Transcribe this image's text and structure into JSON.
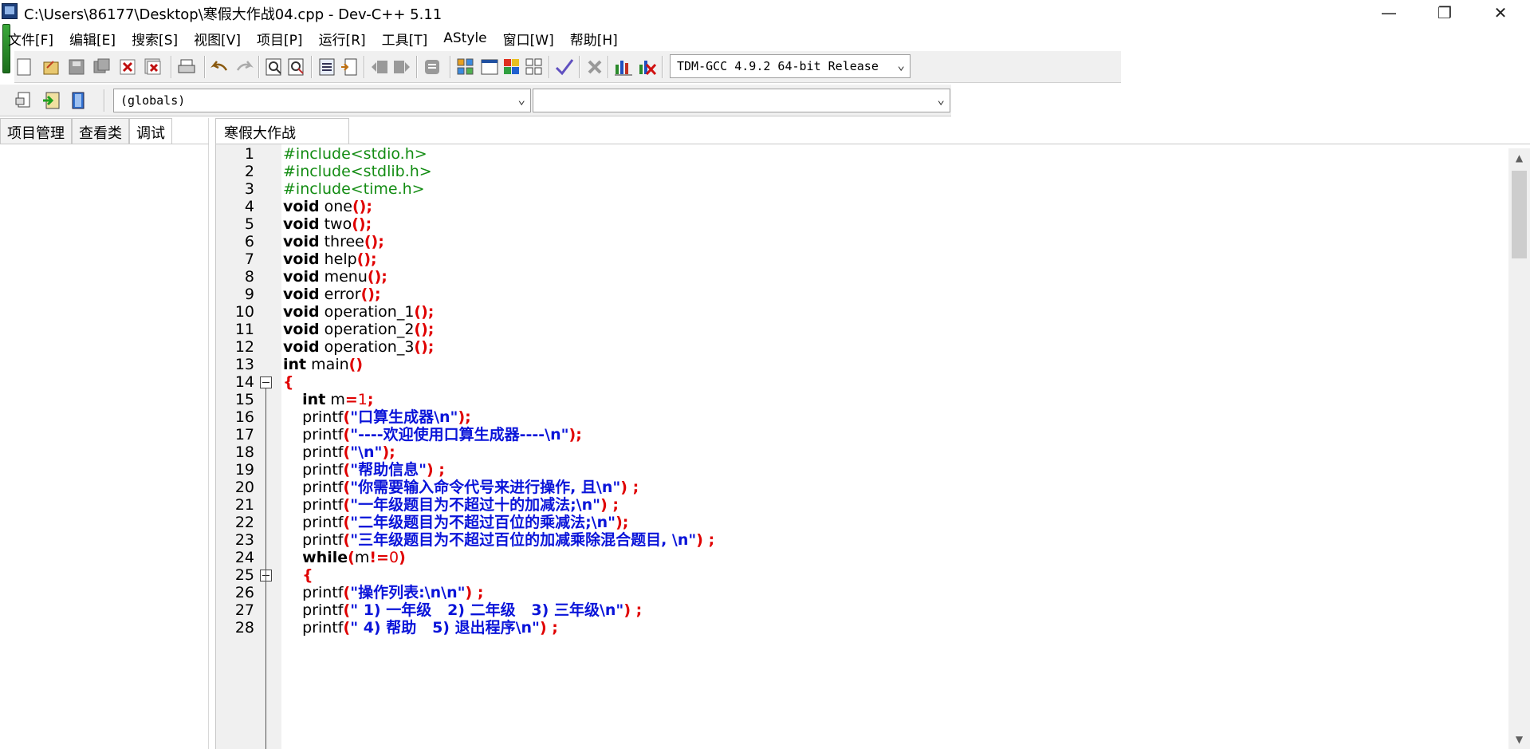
{
  "window": {
    "title": "C:\\Users\\86177\\Desktop\\寒假大作战04.cpp - Dev-C++ 5.11",
    "minimize": "—",
    "restore": "❐",
    "close": "✕"
  },
  "menu": [
    "文件[F]",
    "编辑[E]",
    "搜索[S]",
    "视图[V]",
    "项目[P]",
    "运行[R]",
    "工具[T]",
    "AStyle",
    "窗口[W]",
    "帮助[H]"
  ],
  "toolbar": {
    "compiler_select": "TDM-GCC 4.9.2 64-bit Release",
    "scope_select": "(globals)",
    "member_select": ""
  },
  "left_panel": {
    "tabs": [
      "项目管理",
      "查看类",
      "调试"
    ],
    "active_tab": "调试"
  },
  "editor": {
    "tab": "寒假大作战04.cpp",
    "lines": [
      {
        "n": "1",
        "tokens": [
          [
            "pp",
            "#include<stdio.h>"
          ]
        ]
      },
      {
        "n": "2",
        "tokens": [
          [
            "pp",
            "#include<stdlib.h>"
          ]
        ]
      },
      {
        "n": "3",
        "tokens": [
          [
            "pp",
            "#include<time.h>"
          ]
        ]
      },
      {
        "n": "4",
        "tokens": [
          [
            "kw",
            "void"
          ],
          [
            "id",
            " one"
          ],
          [
            "sym",
            "();"
          ]
        ]
      },
      {
        "n": "5",
        "tokens": [
          [
            "kw",
            "void"
          ],
          [
            "id",
            " two"
          ],
          [
            "sym",
            "();"
          ]
        ]
      },
      {
        "n": "6",
        "tokens": [
          [
            "kw",
            "void"
          ],
          [
            "id",
            " three"
          ],
          [
            "sym",
            "();"
          ]
        ]
      },
      {
        "n": "7",
        "tokens": [
          [
            "kw",
            "void"
          ],
          [
            "id",
            " help"
          ],
          [
            "sym",
            "();"
          ]
        ]
      },
      {
        "n": "8",
        "tokens": [
          [
            "kw",
            "void"
          ],
          [
            "id",
            " menu"
          ],
          [
            "sym",
            "();"
          ]
        ]
      },
      {
        "n": "9",
        "tokens": [
          [
            "kw",
            "void"
          ],
          [
            "id",
            " error"
          ],
          [
            "sym",
            "();"
          ]
        ]
      },
      {
        "n": "10",
        "tokens": [
          [
            "kw",
            "void"
          ],
          [
            "id",
            " operation_1"
          ],
          [
            "sym",
            "();"
          ]
        ]
      },
      {
        "n": "11",
        "tokens": [
          [
            "kw",
            "void"
          ],
          [
            "id",
            " operation_2"
          ],
          [
            "sym",
            "();"
          ]
        ]
      },
      {
        "n": "12",
        "tokens": [
          [
            "kw",
            "void"
          ],
          [
            "id",
            " operation_3"
          ],
          [
            "sym",
            "();"
          ]
        ]
      },
      {
        "n": "13",
        "tokens": [
          [
            "kw",
            "int"
          ],
          [
            "id",
            " main"
          ],
          [
            "sym",
            "()"
          ]
        ]
      },
      {
        "n": "14",
        "tokens": [
          [
            "sym",
            "{"
          ]
        ],
        "fold": true
      },
      {
        "n": "15",
        "tokens": [
          [
            "id",
            "    "
          ],
          [
            "kw",
            "int"
          ],
          [
            "id",
            " m"
          ],
          [
            "sym",
            "="
          ],
          [
            "num",
            "1"
          ],
          [
            "sym",
            ";"
          ]
        ]
      },
      {
        "n": "16",
        "tokens": [
          [
            "id",
            "    printf"
          ],
          [
            "sym",
            "("
          ],
          [
            "str",
            "\"口算生成器\\n\""
          ],
          [
            "sym",
            ");"
          ]
        ]
      },
      {
        "n": "17",
        "tokens": [
          [
            "id",
            "    printf"
          ],
          [
            "sym",
            "("
          ],
          [
            "str",
            "\"----欢迎使用口算生成器----\\n\""
          ],
          [
            "sym",
            ");"
          ]
        ]
      },
      {
        "n": "18",
        "tokens": [
          [
            "id",
            "    printf"
          ],
          [
            "sym",
            "("
          ],
          [
            "str",
            "\"\\n\""
          ],
          [
            "sym",
            ");"
          ]
        ]
      },
      {
        "n": "19",
        "tokens": [
          [
            "id",
            "    printf"
          ],
          [
            "sym",
            "("
          ],
          [
            "str",
            "\"帮助信息\""
          ],
          [
            "sym",
            ") ;"
          ]
        ]
      },
      {
        "n": "20",
        "tokens": [
          [
            "id",
            "    printf"
          ],
          [
            "sym",
            "("
          ],
          [
            "str",
            "\"你需要输入命令代号来进行操作, 且\\n\""
          ],
          [
            "sym",
            ") ;"
          ]
        ]
      },
      {
        "n": "21",
        "tokens": [
          [
            "id",
            "    printf"
          ],
          [
            "sym",
            "("
          ],
          [
            "str",
            "\"一年级题目为不超过十的加减法;\\n\""
          ],
          [
            "sym",
            ") ;"
          ]
        ]
      },
      {
        "n": "22",
        "tokens": [
          [
            "id",
            "    printf"
          ],
          [
            "sym",
            "("
          ],
          [
            "str",
            "\"二年级题目为不超过百位的乘减法;\\n\""
          ],
          [
            "sym",
            ");"
          ]
        ]
      },
      {
        "n": "23",
        "tokens": [
          [
            "id",
            "    printf"
          ],
          [
            "sym",
            "("
          ],
          [
            "str",
            "\"三年级题目为不超过百位的加减乘除混合题目, \\n\""
          ],
          [
            "sym",
            ") ;"
          ]
        ]
      },
      {
        "n": "24",
        "tokens": [
          [
            "id",
            "    "
          ],
          [
            "kw",
            "while"
          ],
          [
            "sym",
            "("
          ],
          [
            "id",
            "m"
          ],
          [
            "sym",
            "!="
          ],
          [
            "num",
            "0"
          ],
          [
            "sym",
            ")"
          ]
        ]
      },
      {
        "n": "25",
        "tokens": [
          [
            "id",
            "    "
          ],
          [
            "sym",
            "{"
          ]
        ],
        "fold": true
      },
      {
        "n": "26",
        "tokens": [
          [
            "id",
            "    printf"
          ],
          [
            "sym",
            "("
          ],
          [
            "str",
            "\"操作列表:\\n\\n\""
          ],
          [
            "sym",
            ") ;"
          ]
        ]
      },
      {
        "n": "27",
        "tokens": [
          [
            "id",
            "    printf"
          ],
          [
            "sym",
            "("
          ],
          [
            "str",
            "\" 1) 一年级   2) 二年级   3) 三年级\\n\""
          ],
          [
            "sym",
            ") ;"
          ]
        ]
      },
      {
        "n": "28",
        "tokens": [
          [
            "id",
            "    printf"
          ],
          [
            "sym",
            "("
          ],
          [
            "str",
            "\" 4) 帮助   5) 退出程序\\n\""
          ],
          [
            "sym",
            ") ;"
          ]
        ]
      }
    ]
  },
  "colors": {
    "preprocessor": "#138c13",
    "keyword": "#000000",
    "symbol": "#e00000",
    "string": "#0a14d9",
    "number": "#e00000"
  }
}
